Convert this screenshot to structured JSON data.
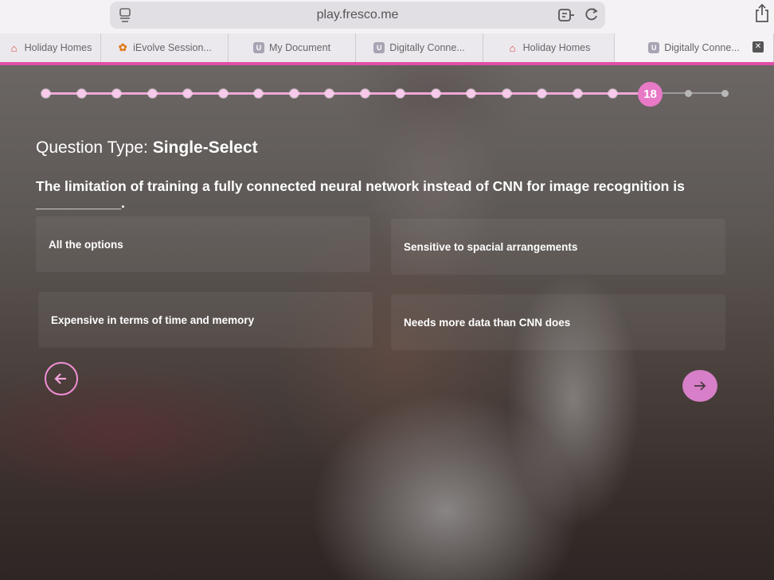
{
  "browser": {
    "url": "play.fresco.me",
    "tabs": [
      {
        "label": "Holiday Homes",
        "icon": "home-icon"
      },
      {
        "label": "iEvolve Session...",
        "icon": "evolve-icon"
      },
      {
        "label": "My Document",
        "icon": "u-doc-icon"
      },
      {
        "label": "Digitally Conne...",
        "icon": "u-doc-icon"
      },
      {
        "label": "Holiday Homes",
        "icon": "home-icon"
      },
      {
        "label": "Digitally Conne...",
        "icon": "u-doc-icon"
      }
    ]
  },
  "quiz": {
    "current_step": "18",
    "total_steps_shown": 20,
    "question_type_prefix": "Question Type:",
    "question_type": "Single-Select",
    "question": "The limitation of training a fully connected neural network instead of CNN for image recognition is ___________.",
    "options": [
      "All the options",
      "Sensitive to spacial arrangements",
      "Expensive in terms of time and memory",
      "Needs more data than CNN does"
    ]
  },
  "colors": {
    "accent": "#e24ea6",
    "progress": "#f0a7d8",
    "current_step_bg": "#e879c6",
    "next_button_bg": "#d77fc8"
  }
}
